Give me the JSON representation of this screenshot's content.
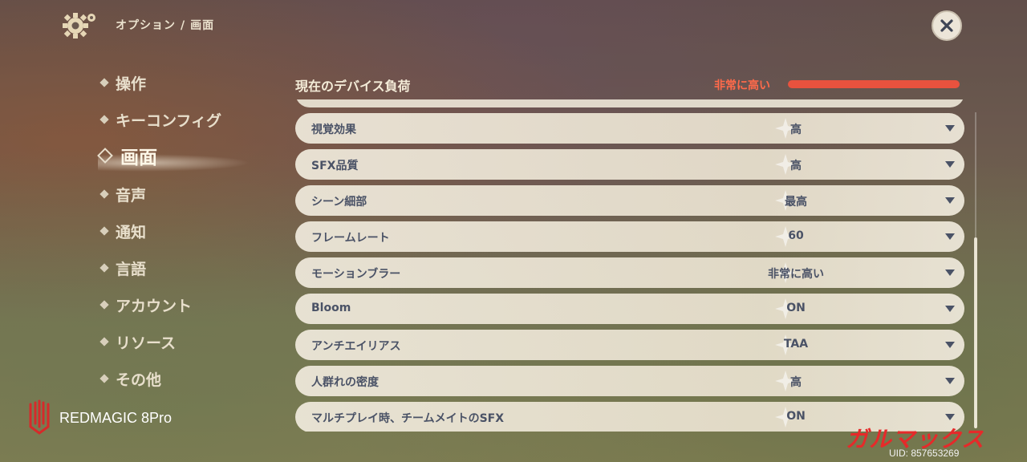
{
  "header": {
    "breadcrumb_root": "オプション",
    "breadcrumb_separator": "/",
    "breadcrumb_current": "画面",
    "icons": {
      "settings": "gear-icon",
      "close": "close-icon"
    }
  },
  "sidebar": {
    "items": [
      {
        "label": "操作",
        "active": false
      },
      {
        "label": "キーコンフィグ",
        "active": false
      },
      {
        "label": "画面",
        "active": true
      },
      {
        "label": "音声",
        "active": false
      },
      {
        "label": "通知",
        "active": false
      },
      {
        "label": "言語",
        "active": false
      },
      {
        "label": "アカウント",
        "active": false
      },
      {
        "label": "リソース",
        "active": false
      },
      {
        "label": "その他",
        "active": false
      }
    ]
  },
  "device_load": {
    "title": "現在のデバイス負荷",
    "value": "非常に高い",
    "level": 1.0,
    "color": "#e8523e"
  },
  "settings": {
    "rows": [
      {
        "label": "視覚効果",
        "value": "高"
      },
      {
        "label": "SFX品質",
        "value": "高"
      },
      {
        "label": "シーン細部",
        "value": "最高"
      },
      {
        "label": "フレームレート",
        "value": "60"
      },
      {
        "label": "モーションブラー",
        "value": "非常に高い"
      },
      {
        "label": "Bloom",
        "value": "ON"
      },
      {
        "label": "アンチエイリアス",
        "value": "TAA"
      },
      {
        "label": "人群れの密度",
        "value": "高"
      },
      {
        "label": "マルチプレイ時、チームメイトのSFX",
        "value": "ON"
      }
    ]
  },
  "watermarks": {
    "device_brand": "REDMAGIC 8Pro",
    "site": "ガルマックス",
    "uid": "UID: 857653269"
  },
  "colors": {
    "text_light": "#ece3cf",
    "text_row": "#4a5266",
    "alert": "#ff6a4a",
    "watermark_red": "#e52a2a"
  }
}
